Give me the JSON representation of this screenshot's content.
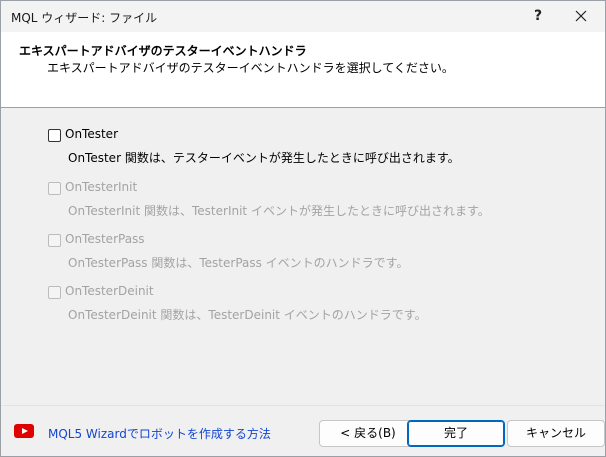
{
  "window": {
    "title": "MQL ウィザード: ファイル",
    "help_label": "?"
  },
  "header": {
    "title": "エキスパートアドバイザのテスターイベントハンドラ",
    "subtitle": "エキスパートアドバイザのテスターイベントハンドラを選択してください。"
  },
  "options": [
    {
      "label": "OnTester",
      "description": "OnTester 関数は、テスターイベントが発生したときに呼び出されます。",
      "checked": false,
      "enabled": true
    },
    {
      "label": "OnTesterInit",
      "description": "OnTesterInit 関数は、TesterInit イベントが発生したときに呼び出されます。",
      "checked": false,
      "enabled": false
    },
    {
      "label": "OnTesterPass",
      "description": "OnTesterPass 関数は、TesterPass イベントのハンドラです。",
      "checked": false,
      "enabled": false
    },
    {
      "label": "OnTesterDeinit",
      "description": "OnTesterDeinit 関数は、TesterDeinit イベントのハンドラです。",
      "checked": false,
      "enabled": false
    }
  ],
  "footer": {
    "link_icon": "youtube-icon",
    "link_text": "MQL5 Wizardでロボットを作成する方法",
    "back_label": "< 戻る(B)",
    "finish_label": "完了",
    "cancel_label": "キャンセル"
  },
  "colors": {
    "link": "#1346d1",
    "primary_border": "#0067c0",
    "youtube_red": "#e00000"
  }
}
